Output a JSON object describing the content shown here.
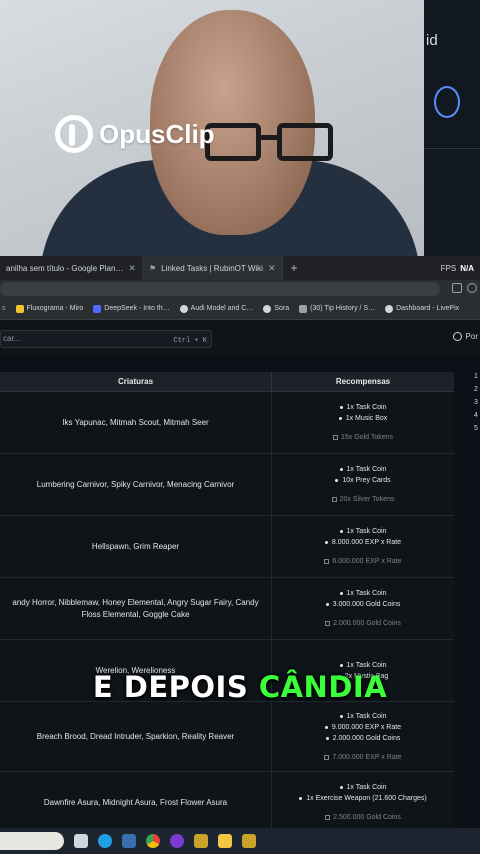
{
  "overlay": {
    "brand": "OpusClip",
    "caption_white": "E DEPOIS",
    "caption_green": "CÂNDIA",
    "side_fragment": "id"
  },
  "browser": {
    "tabs": [
      {
        "label": "anilha sem título - Google Plan…",
        "active": false
      },
      {
        "label": "Linked Tasks | RubinOT Wiki",
        "active": true
      }
    ],
    "fps_label": "FPS",
    "fps_value": "N/A",
    "bookmarks": [
      {
        "label": "Fluxograma - Miro",
        "color": "#f2c230"
      },
      {
        "label": "DeepSeek - Into th…",
        "color": "#4d6bfe"
      },
      {
        "label": "Audi Model and C…",
        "color": "#cfd6dd"
      },
      {
        "label": "Sora",
        "color": "#cfd6dd"
      },
      {
        "label": "(30) Tip History / S…",
        "color": "#9aa0a6"
      },
      {
        "label": "Dashboard - LivePix",
        "color": "#cfd6dd"
      }
    ]
  },
  "wiki": {
    "search_placeholder": "car...",
    "search_shortcut": "Ctrl + K",
    "language": "Por",
    "table": {
      "headers": [
        "Criaturas",
        "Recompensas"
      ],
      "rows": [
        {
          "creatures": "Iks Yapunac, Mitmah Scout, Mitmah Seer",
          "rewards": [
            "1x Task Coin",
            "1x Music Box"
          ],
          "optional": "15x Gold Tokens"
        },
        {
          "creatures": "Lumbering Carnivor, Spiky Carnivor, Menacing Carnivor",
          "rewards": [
            "1x Task Coin",
            "10x Prey Cards"
          ],
          "optional": "20x Silver Tokens"
        },
        {
          "creatures": "Hellspawn, Grim Reaper",
          "rewards": [
            "1x Task Coin",
            "8.000.000 EXP x Rate"
          ],
          "optional": "6.000.000 EXP x Rate"
        },
        {
          "creatures": "andy Horror, Nibblemaw, Honey Elemental, Angry Sugar Fairy, Candy Floss Elemental, Goggle Cake",
          "rewards": [
            "1x Task Coin",
            "3.000.000 Gold Coins"
          ],
          "optional": "2.000.000 Gold Coins"
        },
        {
          "creatures": "Werelion, Werelioness",
          "rewards": [
            "1x Task Coin",
            "2x Mystic Bag"
          ],
          "optional": ""
        },
        {
          "creatures": "Breach Brood, Dread Intruder, Sparkion, Reality Reaver",
          "rewards": [
            "1x Task Coin",
            "9.000.000 EXP x Rate",
            "2.000.000 Gold Coins"
          ],
          "optional": "7.000.000 EXP x Rate"
        },
        {
          "creatures": "Dawnfire Asura, Midnight Asura, Frost Flower Asura",
          "rewards": [
            "1x Task Coin",
            "1x Exercise Weapon (21.600 Charges)"
          ],
          "optional": "2.500.000 Gold Coins"
        }
      ]
    },
    "side_list": [
      "1",
      "2",
      "3",
      "4",
      "5"
    ]
  }
}
